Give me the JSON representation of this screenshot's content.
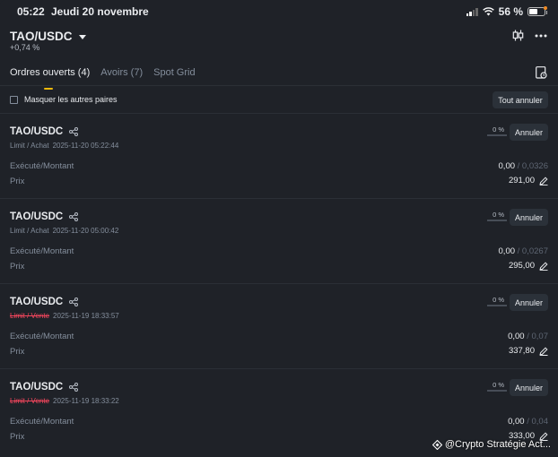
{
  "status_bar": {
    "time": "05:22",
    "date": "Jeudi 20 novembre",
    "battery": "56 %"
  },
  "header": {
    "pair": "TAO/USDC",
    "change": "+0,74 %"
  },
  "tabs": [
    {
      "label": "Ordres ouverts (4)",
      "active": true
    },
    {
      "label": "Avoirs (7)",
      "active": false
    },
    {
      "label": "Spot Grid",
      "active": false
    }
  ],
  "filter": {
    "hide_others_label": "Masquer les autres paires",
    "cancel_all_label": "Tout annuler"
  },
  "labels": {
    "executed_amount": "Exécuté/Montant",
    "price": "Prix",
    "cancel": "Annuler"
  },
  "orders": [
    {
      "symbol": "TAO/USDC",
      "type": "Limit / Achat",
      "side": "buy",
      "datetime": "2025-11-20 05:22:44",
      "progress": "0 %",
      "executed": "0,00",
      "amount": " / 0,0326",
      "price": "291,00"
    },
    {
      "symbol": "TAO/USDC",
      "type": "Limit / Achat",
      "side": "buy",
      "datetime": "2025-11-20 05:00:42",
      "progress": "0 %",
      "executed": "0,00",
      "amount": " / 0,0267",
      "price": "295,00"
    },
    {
      "symbol": "TAO/USDC",
      "type": "Limit / Vente",
      "side": "sell",
      "datetime": "2025-11-19 18:33:57",
      "progress": "0 %",
      "executed": "0,00",
      "amount": " / 0,07",
      "price": "337,80"
    },
    {
      "symbol": "TAO/USDC",
      "type": "Limit / Vente",
      "side": "sell",
      "datetime": "2025-11-19 18:33:22",
      "progress": "0 %",
      "executed": "0,00",
      "amount": " / 0,04",
      "price": "333,00"
    }
  ],
  "watermark": "@Crypto Stratégie Act...",
  "colors": {
    "background": "#1f2228",
    "accent": "#f0b90b",
    "sell": "#f6465d",
    "button": "#2b3139"
  }
}
